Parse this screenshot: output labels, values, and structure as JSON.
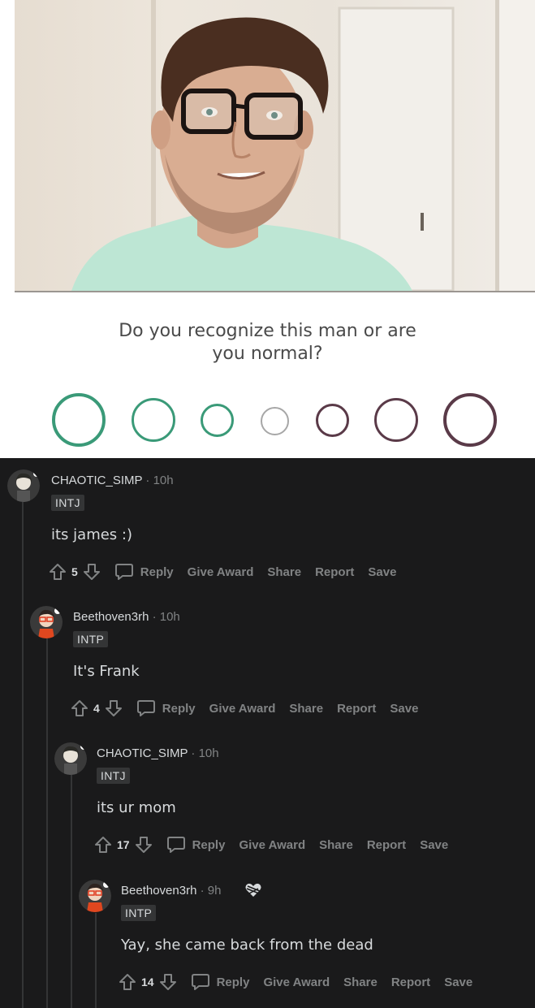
{
  "meme": {
    "question": "Do you recognize this man or are\nyou normal?",
    "scale": {
      "circles": [
        {
          "color": "#3a9a78"
        },
        {
          "color": "#3a9a78"
        },
        {
          "color": "#3a9a78"
        },
        {
          "color": "#a7a7a7"
        },
        {
          "color": "#5a3a48"
        },
        {
          "color": "#5a3a48"
        },
        {
          "color": "#5a3a48"
        }
      ]
    }
  },
  "comments": [
    {
      "username": "CHAOTIC_SIMP",
      "time": " · 10h",
      "flair": "INTJ",
      "body": "its james :)",
      "score": "5",
      "reply": "Reply",
      "give_award": "Give Award",
      "share": "Share",
      "report": "Report",
      "save": "Save"
    },
    {
      "username": "Beethoven3rh",
      "time": " · 10h",
      "flair": "INTP",
      "body": "It's Frank",
      "score": "4",
      "reply": "Reply",
      "give_award": "Give Award",
      "share": "Share",
      "report": "Report",
      "save": "Save"
    },
    {
      "username": "CHAOTIC_SIMP",
      "time": " · 10h",
      "flair": "INTJ",
      "body": "its ur mom",
      "score": "17",
      "reply": "Reply",
      "give_award": "Give Award",
      "share": "Share",
      "report": "Report",
      "save": "Save"
    },
    {
      "username": "Beethoven3rh",
      "time": " · 9h",
      "flair": "INTP",
      "body": "Yay, she came back from the dead",
      "score": "14",
      "award_icon": "bandaged-heart-award-icon",
      "reply": "Reply",
      "give_award": "Give Award",
      "share": "Share",
      "report": "Report",
      "save": "Save"
    }
  ],
  "colors": {
    "background": "#1a1a1b",
    "text": "#d7dadc",
    "muted": "#818384",
    "flair_bg": "#343536"
  }
}
